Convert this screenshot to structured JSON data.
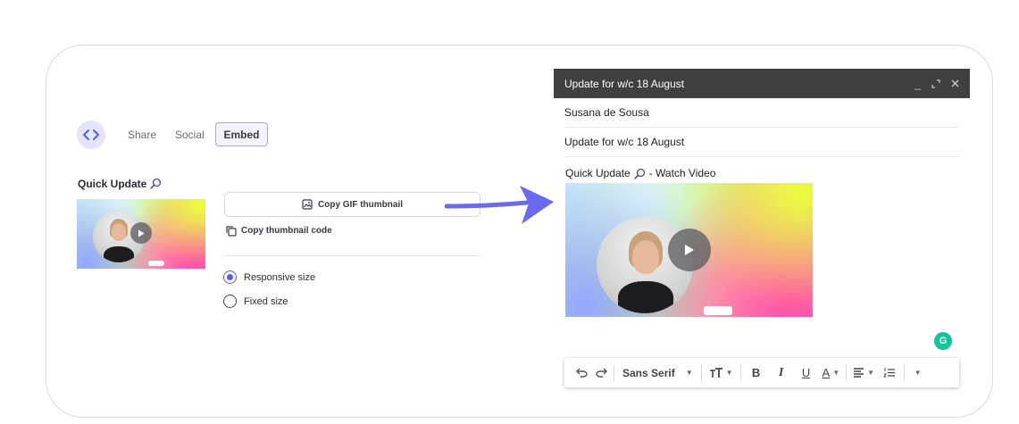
{
  "embed_panel": {
    "tabs": [
      "Share",
      "Social",
      "Embed"
    ],
    "active_tab": "Embed",
    "title": "Quick Update",
    "copy_gif_label": "Copy GIF thumbnail",
    "copy_code_label": "Copy thumbnail code",
    "size_options": [
      {
        "label": "Responsive size",
        "selected": true
      },
      {
        "label": "Fixed size",
        "selected": false
      }
    ],
    "accent_color": "#5b5bf0"
  },
  "compose": {
    "window_title": "Update for w/c 18 August",
    "to": "Susana de Sousa",
    "subject": "Update for w/c 18 August",
    "body_title": "Quick Update",
    "body_link": "- Watch Video",
    "header_color": "#404040"
  },
  "toolbar": {
    "font": "Sans Serif",
    "bold": "B",
    "italic": "I",
    "underline": "U",
    "text_color": "A"
  },
  "grammarly": {
    "label": "G",
    "color": "#15c39a"
  },
  "arrow_color": "#6a6af0"
}
